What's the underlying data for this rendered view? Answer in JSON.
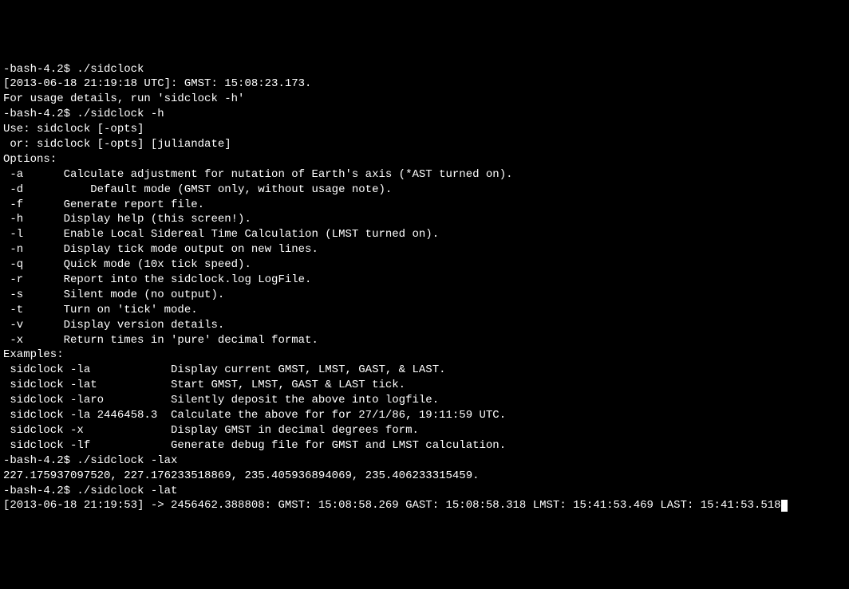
{
  "terminal": {
    "lines": [
      "-bash-4.2$ ./sidclock",
      "[2013-06-18 21:19:18 UTC]: GMST: 15:08:23.173.",
      "For usage details, run 'sidclock -h'",
      "-bash-4.2$ ./sidclock -h",
      "Use: sidclock [-opts]",
      " or: sidclock [-opts] [juliandate]",
      "Options:",
      " -a      Calculate adjustment for nutation of Earth's axis (*AST turned on).",
      " -d          Default mode (GMST only, without usage note).",
      " -f      Generate report file.",
      " -h      Display help (this screen!).",
      " -l      Enable Local Sidereal Time Calculation (LMST turned on).",
      " -n      Display tick mode output on new lines.",
      " -q      Quick mode (10x tick speed).",
      " -r      Report into the sidclock.log LogFile.",
      " -s      Silent mode (no output).",
      " -t      Turn on 'tick' mode.",
      " -v      Display version details.",
      " -x      Return times in 'pure' decimal format.",
      "Examples:",
      " sidclock -la            Display current GMST, LMST, GAST, & LAST.",
      " sidclock -lat           Start GMST, LMST, GAST & LAST tick.",
      " sidclock -laro          Silently deposit the above into logfile.",
      " sidclock -la 2446458.3  Calculate the above for for 27/1/86, 19:11:59 UTC.",
      " sidclock -x             Display GMST in decimal degrees form.",
      " sidclock -lf            Generate debug file for GMST and LMST calculation.",
      "-bash-4.2$ ./sidclock -lax",
      "227.175937097520, 227.176233518869, 235.405936894069, 235.406233315459.",
      "-bash-4.2$ ./sidclock -lat",
      "[2013-06-18 21:19:53] -> 2456462.388808: GMST: 15:08:58.269 GAST: 15:08:58.318 LMST: 15:41:53.469 LAST: 15:41:53.518"
    ],
    "last_line_has_cursor": true
  }
}
